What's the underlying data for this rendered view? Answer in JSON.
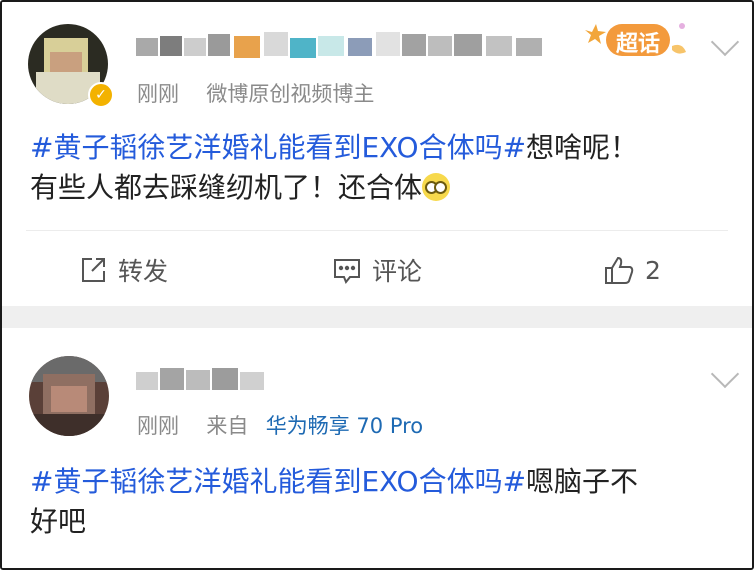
{
  "post1": {
    "timestamp": "刚刚",
    "source": "微博原创视频博主",
    "super_topic_label": "超话",
    "topic": "#黄子韬徐艺洋婚礼能看到EXO合体吗#",
    "text_line1": "想啥呢！",
    "text_line2": "有些人都去踩缝纫机了！还合体",
    "actions": {
      "repost": "转发",
      "comment": "评论",
      "likes": "2"
    }
  },
  "post2": {
    "timestamp": "刚刚",
    "source_prefix": "来自",
    "device": "华为畅享 70 Pro",
    "topic": "#黄子韬徐艺洋婚礼能看到EXO合体吗#",
    "text_line1": "嗯脑子不",
    "text_line2": "好吧"
  },
  "colors": {
    "topic": "#245bdb",
    "meta": "#8a8a8a",
    "device": "#1e6ab3",
    "separator": "#efefef"
  }
}
